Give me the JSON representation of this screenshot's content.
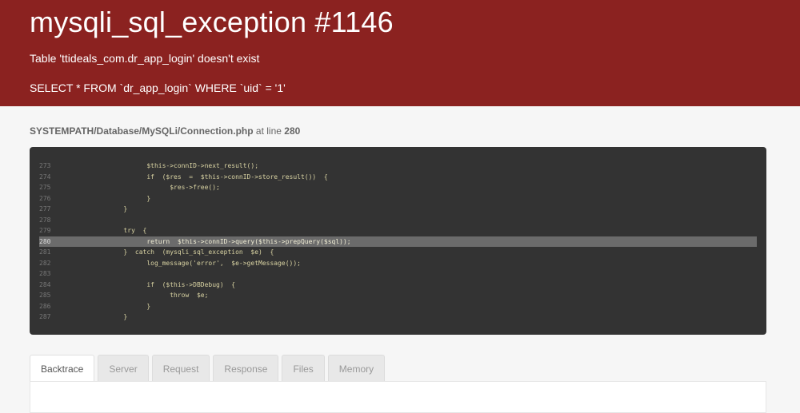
{
  "header": {
    "title": "mysqli_sql_exception #1146",
    "message": "Table 'ttideals_com.dr_app_login' doesn't exist",
    "sql": "SELECT * FROM `dr_app_login` WHERE `uid` = '1'"
  },
  "source": {
    "path": "SYSTEMPATH/Database/MySQLi/Connection.php",
    "at_line_text": " at line ",
    "line": "280"
  },
  "code": {
    "highlight_line": "280",
    "lines": [
      {
        "n": "273",
        "t": "                    $this->connID->next_result();"
      },
      {
        "n": "274",
        "t": "                    if  ($res  =  $this->connID->store_result())  {"
      },
      {
        "n": "275",
        "t": "                          $res->free();"
      },
      {
        "n": "276",
        "t": "                    }"
      },
      {
        "n": "277",
        "t": "              }"
      },
      {
        "n": "278",
        "t": ""
      },
      {
        "n": "279",
        "t": "              try  {"
      },
      {
        "n": "280",
        "t": "                    return  $this->connID->query($this->prepQuery($sql));"
      },
      {
        "n": "281",
        "t": "              }  catch  (mysqli_sql_exception  $e)  {"
      },
      {
        "n": "282",
        "t": "                    log_message('error',  $e->getMessage());"
      },
      {
        "n": "283",
        "t": ""
      },
      {
        "n": "284",
        "t": "                    if  ($this->DBDebug)  {"
      },
      {
        "n": "285",
        "t": "                          throw  $e;"
      },
      {
        "n": "286",
        "t": "                    }"
      },
      {
        "n": "287",
        "t": "              }"
      }
    ]
  },
  "tabs": [
    {
      "label": "Backtrace",
      "active": true
    },
    {
      "label": "Server",
      "active": false
    },
    {
      "label": "Request",
      "active": false
    },
    {
      "label": "Response",
      "active": false
    },
    {
      "label": "Files",
      "active": false
    },
    {
      "label": "Memory",
      "active": false
    }
  ]
}
